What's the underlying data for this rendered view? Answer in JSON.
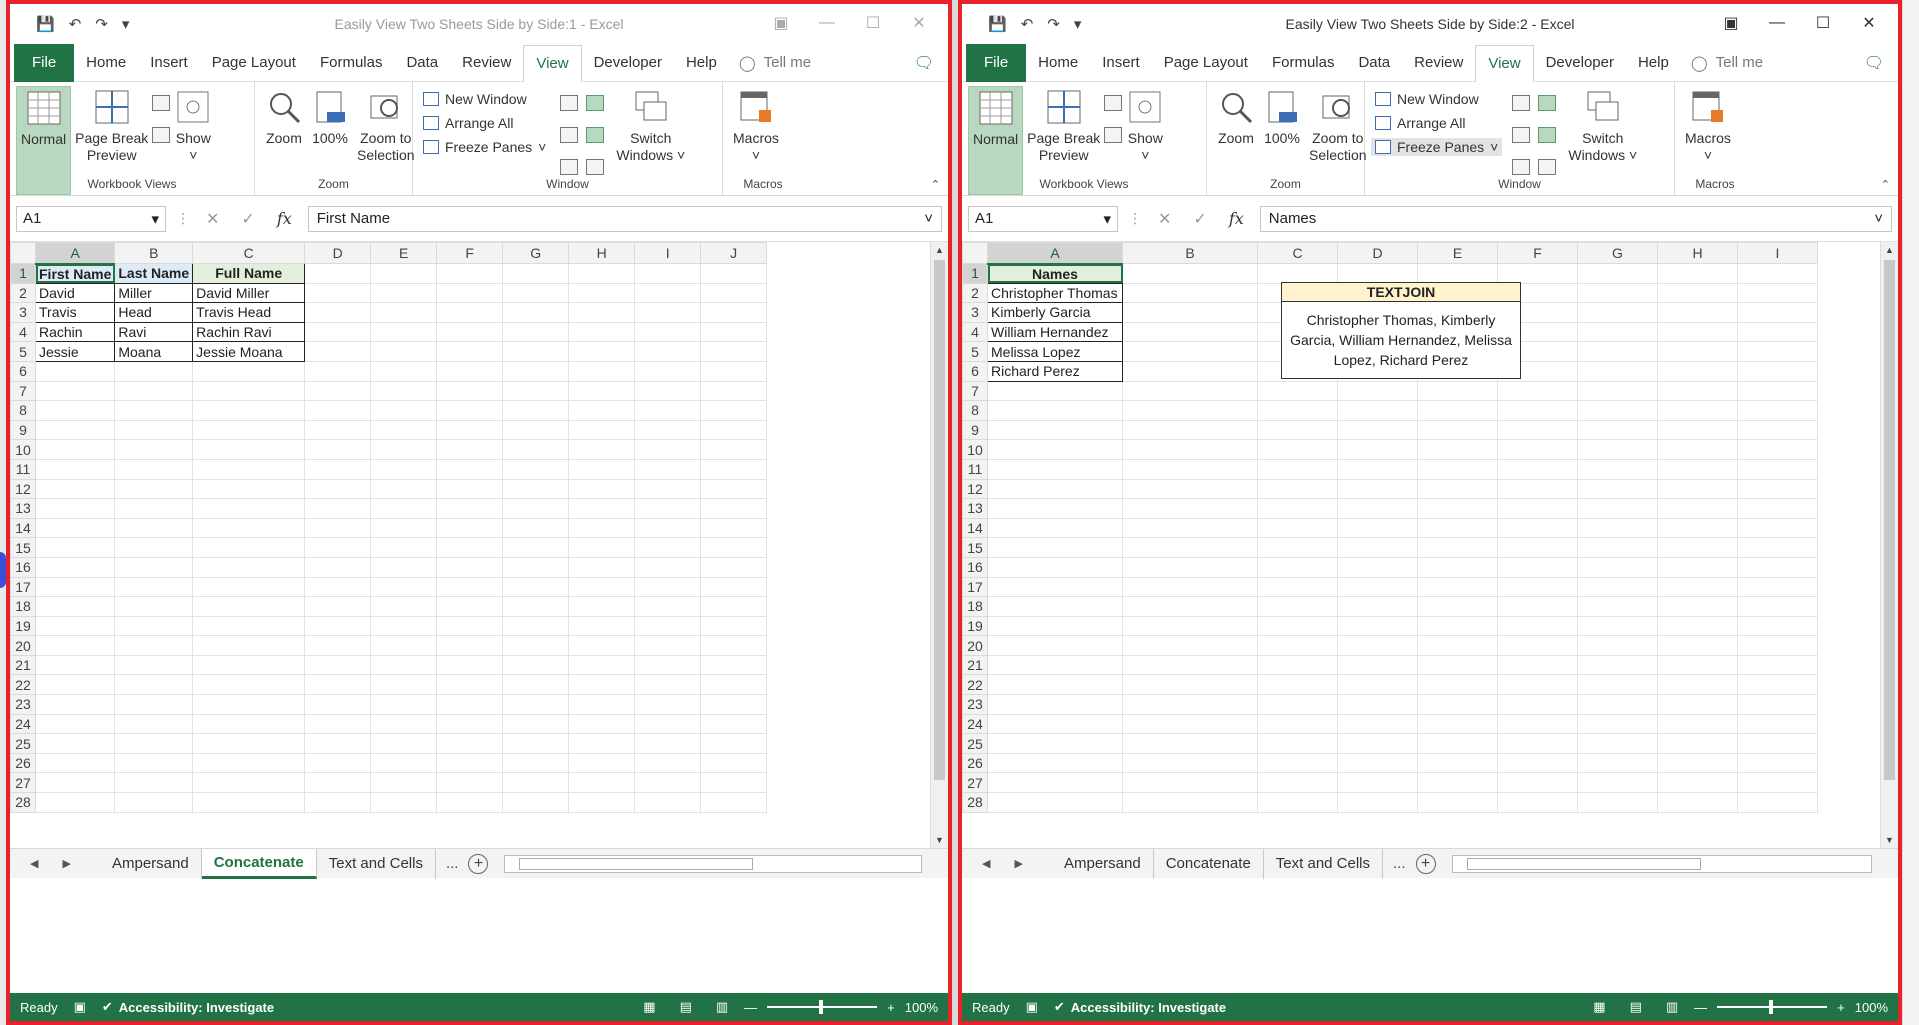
{
  "windows": {
    "left": {
      "title": "Easily View Two Sheets Side by Side:1  -  Excel",
      "name_box": "A1",
      "formula_value": "First Name",
      "columns": [
        "A",
        "B",
        "C",
        "D",
        "E",
        "F",
        "G",
        "H",
        "I",
        "J"
      ],
      "rows": [
        "1",
        "2",
        "3",
        "4",
        "5",
        "6",
        "7",
        "8",
        "9",
        "10",
        "11",
        "12",
        "13",
        "14",
        "15",
        "16",
        "17",
        "18",
        "19",
        "20",
        "21",
        "22",
        "23",
        "24",
        "25",
        "26",
        "27",
        "28"
      ],
      "table": {
        "headers": [
          "First Name",
          "Last Name",
          "Full Name"
        ],
        "data": [
          [
            "David",
            "Miller",
            "David Miller"
          ],
          [
            "Travis",
            "Head",
            "Travis Head"
          ],
          [
            "Rachin",
            "Ravi",
            "Rachin Ravi"
          ],
          [
            "Jessie",
            "Moana",
            "Jessie Moana"
          ]
        ]
      },
      "sheet_tabs": [
        "Ampersand",
        "Concatenate",
        "Text and Cells"
      ],
      "active_tab": "Concatenate"
    },
    "right": {
      "title": "Easily View Two Sheets Side by Side:2  -  Excel",
      "name_box": "A1",
      "formula_value": "Names",
      "columns": [
        "A",
        "B",
        "C",
        "D",
        "E",
        "F",
        "G",
        "H",
        "I"
      ],
      "rows": [
        "1",
        "2",
        "3",
        "4",
        "5",
        "6",
        "7",
        "8",
        "9",
        "10",
        "11",
        "12",
        "13",
        "14",
        "15",
        "16",
        "17",
        "18",
        "19",
        "20",
        "21",
        "22",
        "23",
        "24",
        "25",
        "26",
        "27",
        "28"
      ],
      "names_header": "Names",
      "names": [
        "Christopher Thomas",
        "Kimberly Garcia",
        "William Hernandez",
        "Melissa Lopez",
        "Richard Perez"
      ],
      "textjoin": {
        "header": "TEXTJOIN",
        "result": "Christopher Thomas, Kimberly Garcia, William Hernandez, Melissa Lopez, Richard Perez"
      },
      "sheet_tabs": [
        "Ampersand",
        "Concatenate",
        "Text and Cells"
      ]
    }
  },
  "menu": {
    "file": "File",
    "items": [
      "Home",
      "Insert",
      "Page Layout",
      "Formulas",
      "Data",
      "Review",
      "View",
      "Developer",
      "Help"
    ],
    "active": "View",
    "tell_me": "Tell me"
  },
  "ribbon": {
    "normal": "Normal",
    "page_break_1": "Page Break",
    "page_break_2": "Preview",
    "show": "Show",
    "zoom": "Zoom",
    "zoom100": "100%",
    "zoom_sel_1": "Zoom to",
    "zoom_sel_2": "Selection",
    "new_window": "New Window",
    "arrange_all": "Arrange All",
    "freeze_panes": "Freeze Panes",
    "switch_1": "Switch",
    "switch_2": "Windows",
    "macros": "Macros",
    "groups": {
      "workbook_views": "Workbook Views",
      "zoom": "Zoom",
      "window": "Window",
      "macros": "Macros"
    }
  },
  "tabs_more": "...",
  "status": {
    "ready": "Ready",
    "accessibility": "Accessibility: Investigate",
    "zoom": "100%"
  },
  "colors": {
    "excel_green": "#217346",
    "window_border": "#e8212b",
    "header_blue": "#ddebf7",
    "header_green": "#e2efda",
    "textjoin_yellow": "#fff2cc"
  }
}
